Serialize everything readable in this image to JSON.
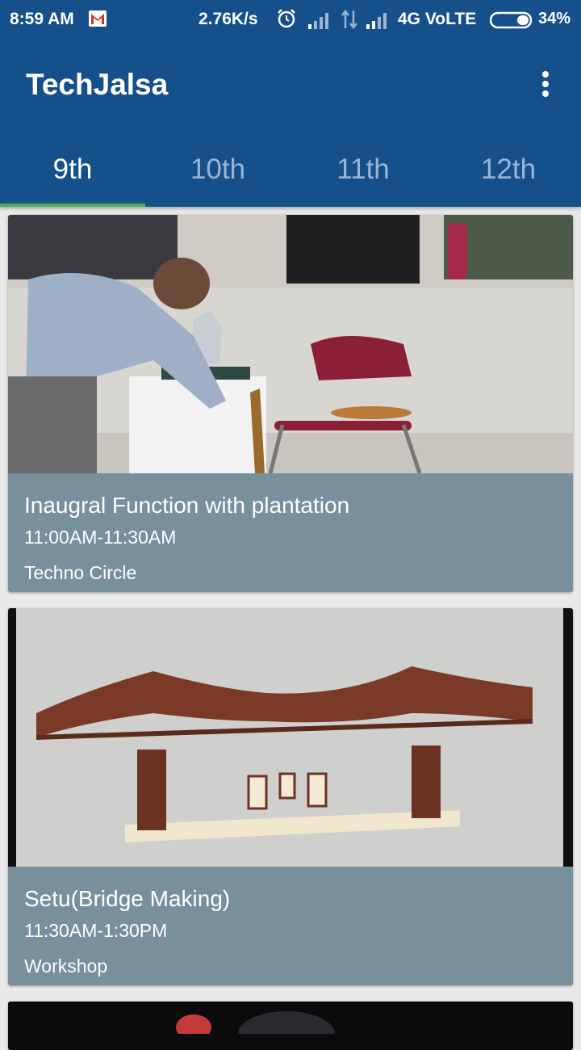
{
  "status_bar": {
    "time": "8:59 AM",
    "speed": "2.76K/s",
    "network": "4G VoLTE",
    "battery": "34%",
    "icons": [
      "gmail-icon",
      "alarm-icon",
      "signal-icon",
      "data-arrows-icon",
      "signal-icon",
      "battery-icon"
    ]
  },
  "app_bar": {
    "title": "TechJalsa",
    "menu_icon": "more-vert-icon"
  },
  "tabs": [
    {
      "label": "9th",
      "active": true
    },
    {
      "label": "10th",
      "active": false
    },
    {
      "label": "11th",
      "active": false
    },
    {
      "label": "12th",
      "active": false
    }
  ],
  "events": [
    {
      "title": "Inaugral Function with plantation",
      "time": "11:00AM-11:30AM",
      "venue": "Techno Circle"
    },
    {
      "title": "Setu(Bridge Making)",
      "time": "11:30AM-1:30PM",
      "venue": "Workshop"
    }
  ],
  "colors": {
    "primary": "#15508a",
    "card": "#788f9c",
    "tab_indicator": "#4caf50",
    "tab_inactive": "#9bb6d3"
  }
}
